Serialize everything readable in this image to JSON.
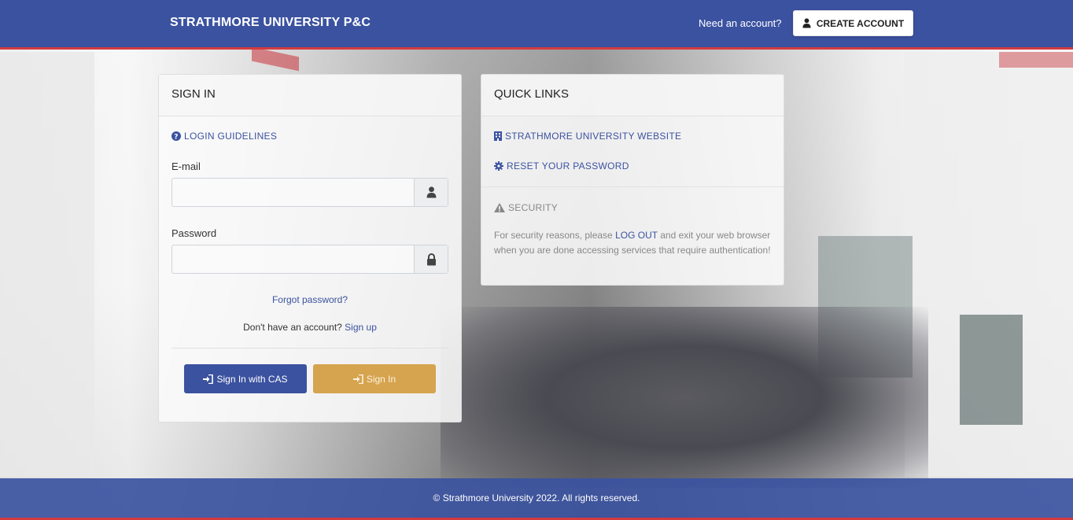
{
  "navbar": {
    "brand": "STRATHMORE UNIVERSITY P&C",
    "need_account": "Need an account?",
    "create_account": "CREATE ACCOUNT"
  },
  "signin": {
    "title": "SIGN IN",
    "guidelines": "LOGIN GUIDELINES",
    "email_label": "E-mail",
    "email_value": "",
    "password_label": "Password",
    "password_value": "",
    "forgot": "Forgot password?",
    "no_account": "Don't have an account?",
    "sign_up": "Sign up",
    "cas_button": "Sign In with CAS",
    "signin_button": "Sign In"
  },
  "quick_links": {
    "title": "QUICK LINKS",
    "website": "STRATHMORE UNIVERSITY WEBSITE",
    "reset": "RESET YOUR PASSWORD",
    "security_title": "SECURITY",
    "security_text_before": "For security reasons, please",
    "security_logout": "LOG OUT",
    "security_text_after": "and exit your web browser when you are done accessing services that require authentication!"
  },
  "footer": {
    "text": "© Strathmore University 2022. All rights reserved."
  },
  "colors": {
    "primary": "#3b52a0",
    "accent_red": "#d33a3f",
    "signin_gold": "#d6a34f"
  },
  "icons": {
    "create_account": "user-icon",
    "guidelines": "question-circle-icon",
    "email_addon": "user-icon",
    "password_addon": "lock-icon",
    "cas": "sign-in-icon",
    "signin": "sign-in-icon",
    "website": "building-icon",
    "reset": "gear-icon",
    "security": "warning-icon"
  }
}
